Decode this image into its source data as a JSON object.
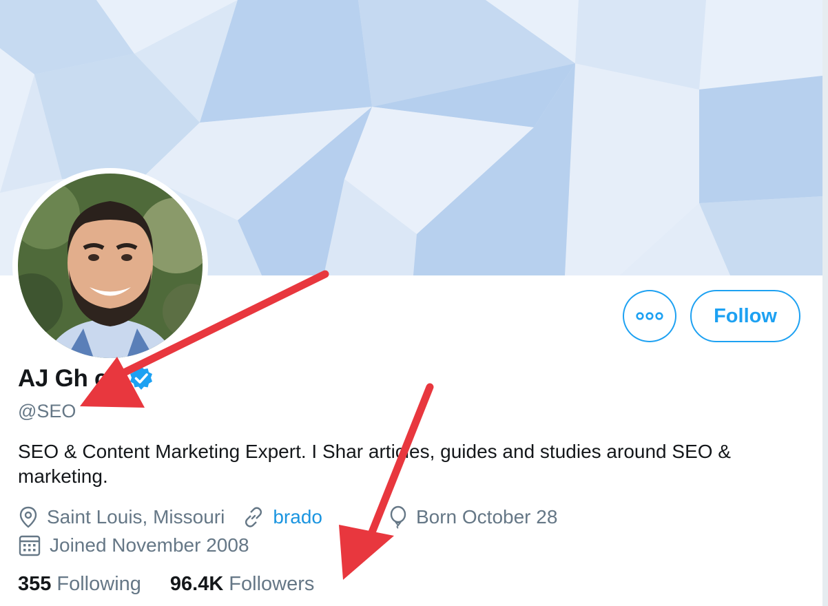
{
  "profile": {
    "name": "AJ Gh    ch",
    "handle": "@SEO",
    "verified": true,
    "bio": "SEO & Content Marketing Expert. I Shar  articles, guides and studies around SEO & marketing.",
    "location": "Saint Louis, Missouri",
    "website": "brado",
    "birthday": "Born October 28",
    "joined": "Joined November 2008"
  },
  "actions": {
    "more_icon": "more-dots-icon",
    "follow_label": "Follow"
  },
  "stats": {
    "following_count": "355",
    "following_label": "Following",
    "followers_count": "96.4K",
    "followers_label": "Followers"
  },
  "colors": {
    "accent": "#1da1f2",
    "link": "#1b95e0",
    "muted": "#657786",
    "text": "#14171a",
    "annotation_arrow": "#e8373e",
    "banner_light": "#e8f0fa",
    "banner_mid": "#c9dcf1",
    "banner_dark": "#b3cfee"
  },
  "icons": [
    "location-pin-icon",
    "link-icon",
    "balloon-icon",
    "calendar-icon",
    "verified-badge-icon"
  ]
}
